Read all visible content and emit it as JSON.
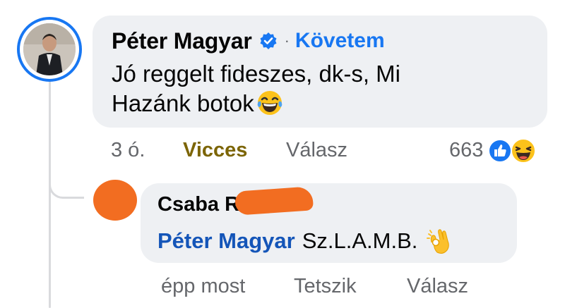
{
  "comment": {
    "author": "Péter Magyar",
    "separator": "·",
    "follow_label": "Követem",
    "text": "Jó reggelt fideszes, dk-s, Mi Hazánk botok",
    "emoji": "rolling-on-floor-laughing",
    "meta": {
      "time": "3 ó.",
      "reaction_label": "Vicces",
      "reply_label": "Válasz",
      "reaction_count": "663",
      "reaction_icons": [
        "like-icon",
        "haha-icon"
      ]
    }
  },
  "reply": {
    "author": "Csaba R",
    "mention": "Péter Magyar",
    "text": "Sz.L.A.M.B.",
    "emoji": "ok-hand",
    "meta": {
      "time": "épp most",
      "like_label": "Tetszik",
      "reply_label": "Válasz"
    }
  },
  "colors": {
    "accent_blue": "#1877f2",
    "bubble": "#eef0f3",
    "haha_label": "#7c6506",
    "redaction": "#f26d21",
    "secondary_text": "#65676b"
  }
}
